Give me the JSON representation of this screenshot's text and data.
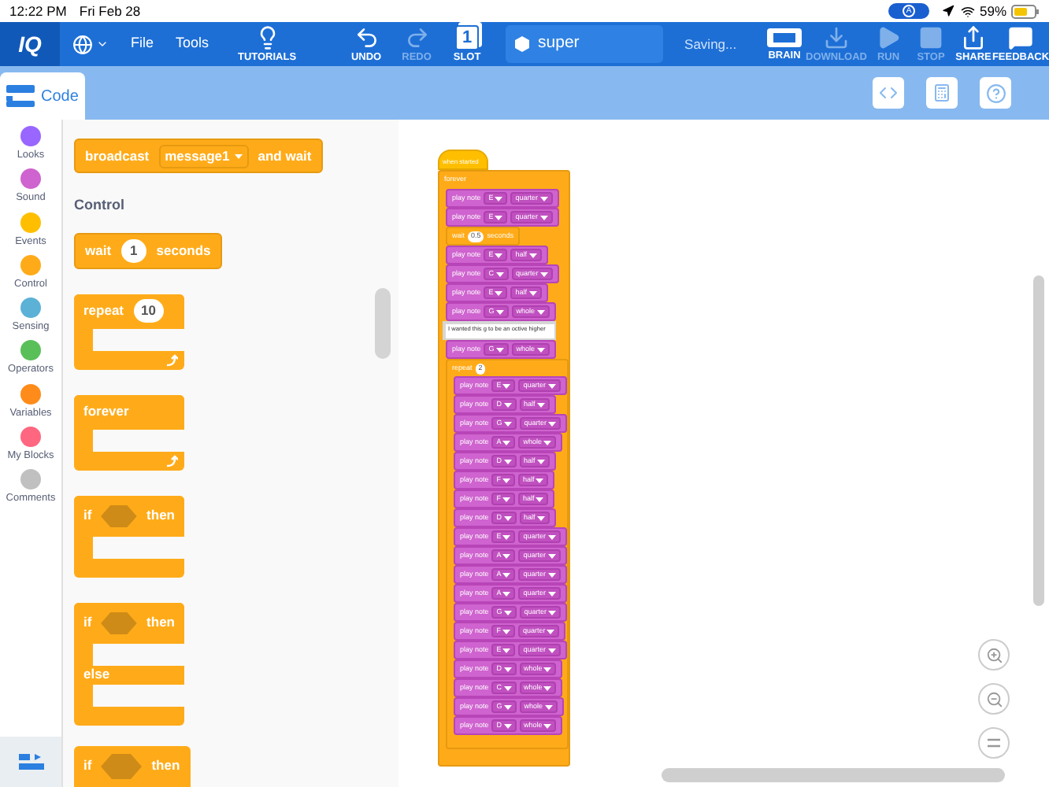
{
  "status_bar": {
    "time": "12:22 PM",
    "date": "Fri Feb 28",
    "indicator": "A",
    "battery": "59%"
  },
  "toolbar": {
    "logo": "IQ",
    "menus": [
      "File",
      "Tools"
    ],
    "left_tools": [
      {
        "label": "TUTORIALS",
        "kind": "bulb",
        "disabled": false
      }
    ],
    "edit_tools": [
      {
        "label": "UNDO",
        "kind": "undo",
        "disabled": false
      },
      {
        "label": "REDO",
        "kind": "redo",
        "disabled": true
      },
      {
        "label": "SLOT",
        "kind": "slot",
        "slot_number": "1",
        "disabled": false
      }
    ],
    "project_name": "super",
    "save_status": "Saving...",
    "right_tools": [
      {
        "label": "BRAIN",
        "kind": "brain",
        "disabled": false
      },
      {
        "label": "DOWNLOAD",
        "kind": "download",
        "disabled": true
      },
      {
        "label": "RUN",
        "kind": "run",
        "disabled": true
      },
      {
        "label": "STOP",
        "kind": "stop",
        "disabled": true
      },
      {
        "label": "SHARE",
        "kind": "share",
        "disabled": false
      },
      {
        "label": "FEEDBACK",
        "kind": "feedback",
        "disabled": false
      }
    ]
  },
  "tabs": [
    {
      "label": "Code",
      "selected": true
    }
  ],
  "categories": [
    {
      "label": "Looks",
      "color": "#9966ff"
    },
    {
      "label": "Sound",
      "color": "#cf63cf"
    },
    {
      "label": "Events",
      "color": "#ffbf00"
    },
    {
      "label": "Control",
      "color": "#ffab19"
    },
    {
      "label": "Sensing",
      "color": "#5cb1d6"
    },
    {
      "label": "Operators",
      "color": "#59c059"
    },
    {
      "label": "Variables",
      "color": "#ff8c1a"
    },
    {
      "label": "My Blocks",
      "color": "#ff6680"
    },
    {
      "label": "Comments",
      "color": "#c0c0c0"
    }
  ],
  "palette": {
    "heading": "Control",
    "blocks": [
      {
        "kind": "broadcast",
        "label": "broadcast",
        "value": "message1",
        "suffix": "and wait"
      },
      {
        "kind": "heading"
      },
      {
        "kind": "wait",
        "label": "wait",
        "value": "1",
        "suffix": "seconds"
      },
      {
        "kind": "repeat",
        "label": "repeat",
        "value": "10"
      },
      {
        "kind": "forever",
        "label": "forever"
      },
      {
        "kind": "if",
        "label": "if",
        "suffix": "then"
      },
      {
        "kind": "if_else",
        "label": "if",
        "suffix": "then",
        "else_label": "else"
      },
      {
        "kind": "if_cut",
        "label": "if",
        "suffix": "then"
      }
    ]
  },
  "script": {
    "hat": "when started",
    "loop": "forever",
    "children": [
      {
        "kind": "note",
        "label": "play note",
        "note": "E",
        "duration": "quarter"
      },
      {
        "kind": "note",
        "label": "play note",
        "note": "E",
        "duration": "quarter"
      },
      {
        "kind": "wait",
        "label": "wait",
        "value": "0.5",
        "suffix": "seconds"
      },
      {
        "kind": "note",
        "label": "play note",
        "note": "E",
        "duration": "half"
      },
      {
        "kind": "note",
        "label": "play note",
        "note": "C",
        "duration": "quarter"
      },
      {
        "kind": "note",
        "label": "play note",
        "note": "E",
        "duration": "half"
      },
      {
        "kind": "note",
        "label": "play note",
        "note": "G",
        "duration": "whole"
      },
      {
        "kind": "comment",
        "text": "I wanted this g to be an octive higher"
      },
      {
        "kind": "note",
        "label": "play note",
        "note": "G",
        "duration": "whole"
      },
      {
        "kind": "repeat",
        "label": "repeat",
        "value": "2",
        "children": [
          {
            "kind": "note",
            "label": "play note",
            "note": "E",
            "duration": "quarter"
          },
          {
            "kind": "note",
            "label": "play note",
            "note": "D",
            "duration": "half"
          },
          {
            "kind": "note",
            "label": "play note",
            "note": "G",
            "duration": "quarter"
          },
          {
            "kind": "note",
            "label": "play note",
            "note": "A",
            "duration": "whole"
          },
          {
            "kind": "note",
            "label": "play note",
            "note": "D",
            "duration": "half"
          },
          {
            "kind": "note",
            "label": "play note",
            "note": "F",
            "duration": "half"
          },
          {
            "kind": "note",
            "label": "play note",
            "note": "F",
            "duration": "half"
          },
          {
            "kind": "note",
            "label": "play note",
            "note": "D",
            "duration": "half"
          },
          {
            "kind": "note",
            "label": "play note",
            "note": "E",
            "duration": "quarter"
          },
          {
            "kind": "note",
            "label": "play note",
            "note": "A",
            "duration": "quarter"
          },
          {
            "kind": "note",
            "label": "play note",
            "note": "A",
            "duration": "quarter"
          },
          {
            "kind": "note",
            "label": "play note",
            "note": "A",
            "duration": "quarter"
          },
          {
            "kind": "note",
            "label": "play note",
            "note": "G",
            "duration": "quarter"
          },
          {
            "kind": "note",
            "label": "play note",
            "note": "F",
            "duration": "quarter"
          },
          {
            "kind": "note",
            "label": "play note",
            "note": "E",
            "duration": "quarter"
          },
          {
            "kind": "note",
            "label": "play note",
            "note": "D",
            "duration": "whole"
          },
          {
            "kind": "note",
            "label": "play note",
            "note": "C",
            "duration": "whole"
          },
          {
            "kind": "note",
            "label": "play note",
            "note": "G",
            "duration": "whole"
          },
          {
            "kind": "note",
            "label": "play note",
            "note": "D",
            "duration": "whole"
          }
        ]
      }
    ]
  }
}
